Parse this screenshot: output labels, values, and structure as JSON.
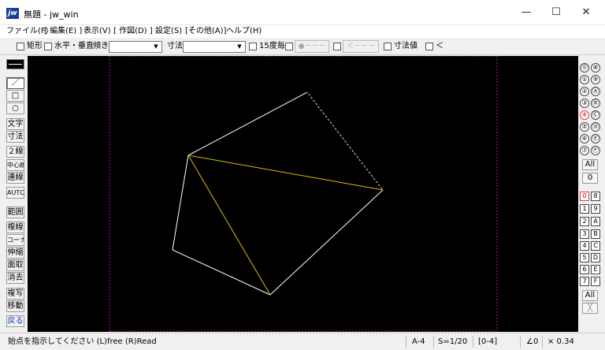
{
  "window": {
    "title": "無題 - jw_win",
    "icon_text": "jw",
    "minimize": "—",
    "maximize": "☐",
    "close": "✕"
  },
  "menu": [
    "ファイル(F)",
    "[ 編集(E) ]",
    "表示(V)",
    "[ 作図(D) ]",
    "設定(S)",
    "[その他(A)]",
    "ヘルプ(H)"
  ],
  "toolbar": {
    "rect": "矩形",
    "hv": "水平・垂直",
    "tilt": "傾き",
    "tilt_value": "",
    "dim": "寸法",
    "dim_value": "",
    "deg15": "15度毎",
    "disabled1": "●－－－",
    "disabled2": "＜－－－－",
    "dimval": "寸法値",
    "lt": "＜"
  },
  "left_tools": [
    "／",
    "□",
    "○",
    "文字",
    "寸法",
    "２線",
    "中心線",
    "連線",
    "AUTO",
    "範囲",
    "複線",
    "コーナー",
    "伸縮",
    "面取",
    "消去",
    "複写",
    "移動",
    "戻る"
  ],
  "right_panel": {
    "pen_groups": [
      "⓪",
      "①",
      "②",
      "③",
      "④",
      "⑤",
      "⑥",
      "⑦"
    ],
    "pen_groups_hex": [
      "⑧",
      "⑨",
      "Ⓐ",
      "Ⓑ",
      "Ⓒ",
      "Ⓓ",
      "Ⓔ",
      "Ⓕ"
    ],
    "all_label": "All",
    "zero_label": "0",
    "layers": [
      "0",
      "1",
      "2",
      "3",
      "4",
      "5",
      "6",
      "7"
    ],
    "layers_hex": [
      "8",
      "9",
      "A",
      "B",
      "C",
      "D",
      "E",
      "F"
    ],
    "all2_label": "All",
    "x_label": "╳"
  },
  "status": {
    "hint": "始点を指示してください (L)free (R)Read",
    "paper": "A-4",
    "scale": "S=1/20",
    "layer": "[0-4]",
    "angle": "∠0",
    "zoom": "× 0.34"
  },
  "colors": {
    "canvas_bg": "#000000",
    "pentagon_line": "#ffffff",
    "diagonal_line": "#d8c000",
    "frame_line": "#a01aa0",
    "accent_red": "#e04040"
  }
}
